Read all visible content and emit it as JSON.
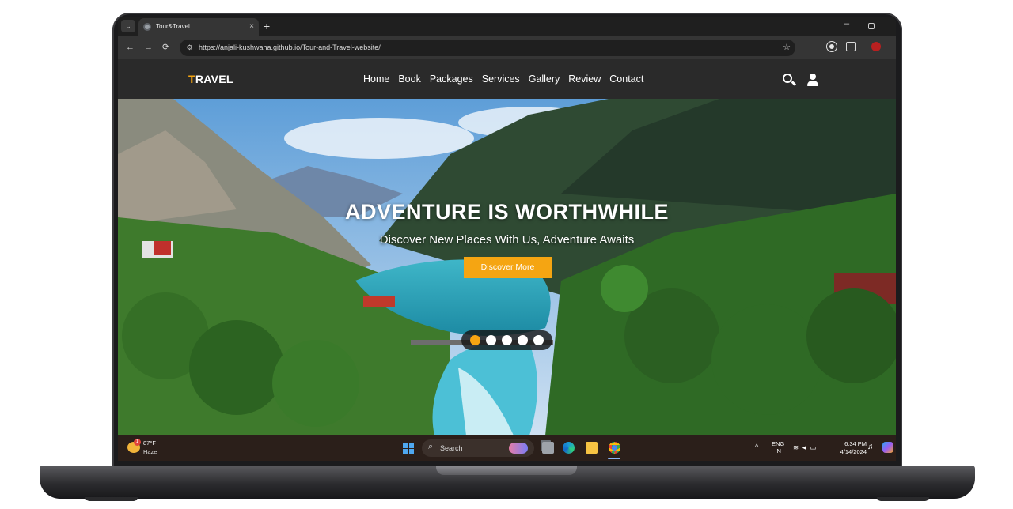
{
  "browser": {
    "tab_title": "Tour&Travel",
    "tab_close": "×",
    "new_tab": "+",
    "url": "https://anjali-kushwaha.github.io/Tour-and-Travel-website/",
    "back": "←",
    "forward": "→",
    "reload": "⟳",
    "bookmark_star": "☆",
    "minimize": "–"
  },
  "site": {
    "logo_first": "T",
    "logo_rest": "RAVEL",
    "nav": [
      "Home",
      "Book",
      "Packages",
      "Services",
      "Gallery",
      "Review",
      "Contact"
    ],
    "hero_title": "ADVENTURE IS WORTHWHILE",
    "hero_subtitle": "Discover New Places With Us, Adventure Awaits",
    "cta_label": "Discover More",
    "slides_total": 5,
    "slide_active": 1,
    "accent_color": "#f5a512"
  },
  "taskbar": {
    "weather_badge": "1",
    "weather_temp": "87°F",
    "weather_cond": "Haze",
    "search_label": "Search",
    "lang_top": "ENG",
    "lang_bottom": "IN",
    "time": "6:34 PM",
    "date": "4/14/2024"
  }
}
